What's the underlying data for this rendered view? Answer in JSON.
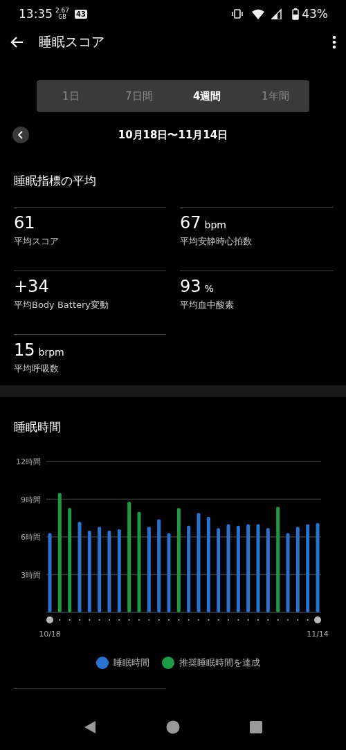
{
  "status_bar": {
    "time": "13:35",
    "data_speed": "2.67",
    "data_unit": "GB",
    "notification_badge": "43",
    "battery": "43%"
  },
  "header": {
    "title": "睡眠スコア"
  },
  "tabs": [
    {
      "label": "1日",
      "selected": false
    },
    {
      "label": "7日間",
      "selected": false
    },
    {
      "label": "4週間",
      "selected": true
    },
    {
      "label": "1年間",
      "selected": false
    }
  ],
  "date_range": "10月18日〜11月14日",
  "averages": {
    "title": "睡眠指標の平均",
    "metrics": [
      {
        "value": "61",
        "label": "平均スコア"
      },
      {
        "value": "67",
        "unit": "bpm",
        "label": "平均安静時心拍数"
      },
      {
        "value": "+34",
        "label": "平均Body Battery変動"
      },
      {
        "value": "93",
        "unit": "%",
        "label": "平均血中酸素"
      },
      {
        "value": "15",
        "unit": "brpm",
        "label": "平均呼吸数"
      }
    ]
  },
  "sleep_time": {
    "title": "睡眠時間",
    "chart_data": {
      "type": "bar",
      "stacked": true,
      "categories": [
        "10/18",
        null,
        null,
        null,
        null,
        null,
        null,
        null,
        null,
        null,
        null,
        null,
        null,
        null,
        null,
        null,
        null,
        null,
        null,
        null,
        null,
        null,
        null,
        null,
        null,
        null,
        null,
        "11/14"
      ],
      "grid": true,
      "series": [
        {
          "name": "睡眠時間",
          "color": "#2a72d0",
          "values": [
            6.3,
            null,
            null,
            7.2,
            6.5,
            6.8,
            6.5,
            6.6,
            null,
            null,
            6.8,
            7.4,
            6.3,
            null,
            6.9,
            7.9,
            7.6,
            6.7,
            7.0,
            6.9,
            7.0,
            7.0,
            6.7,
            null,
            6.3,
            6.8,
            7.0,
            7.1
          ]
        },
        {
          "name": "推奨睡眠時間を達成",
          "color": "#1e9a46",
          "values": [
            null,
            9.5,
            8.3,
            null,
            null,
            null,
            null,
            null,
            8.8,
            8.0,
            null,
            null,
            null,
            8.3,
            null,
            null,
            null,
            null,
            null,
            null,
            null,
            null,
            null,
            8.4,
            null,
            null,
            null,
            null
          ]
        }
      ],
      "ylim": [
        0,
        12
      ],
      "yticks": [
        {
          "value": 3,
          "label": "3時間"
        },
        {
          "value": 6,
          "label": "6時間"
        },
        {
          "value": 9,
          "label": "9時間"
        },
        {
          "value": 12,
          "label": "12時間"
        }
      ]
    }
  }
}
